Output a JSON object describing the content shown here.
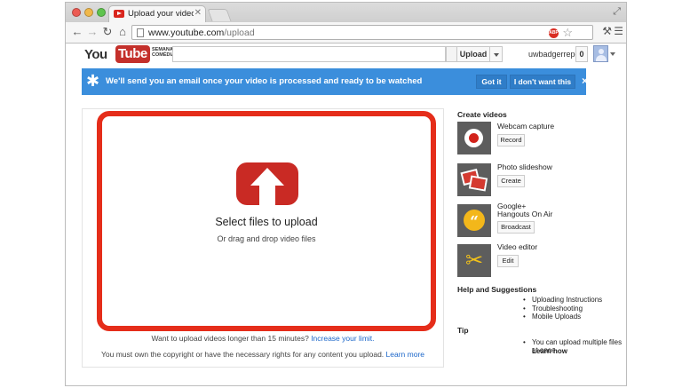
{
  "browser": {
    "tab_title": "Upload your video - YouTube",
    "url_scheme": "www.youtube.com",
    "url_path": "/upload",
    "abp_badge": "ABP"
  },
  "header": {
    "logo_you": "You",
    "logo_tube": "Tube",
    "logo_tagline": "SEMANA DA COMÉDIA",
    "upload_label": "Upload",
    "username": "uwbadgerreport",
    "notification_count": "0"
  },
  "notice": {
    "message": "We'll send you an email once your video is processed and ready to be watched",
    "got_it": "Got it",
    "dont_want": "I don't want this",
    "close": "×"
  },
  "upload": {
    "select_files": "Select files to upload",
    "drag_drop": "Or drag and drop video files",
    "long_prefix": "Want to upload videos longer than 15 minutes?",
    "long_link": "Increase your limit.",
    "copyright_prefix": "You must own the copyright or have the necessary rights for any content you upload.",
    "copyright_link": "Learn more"
  },
  "sidebar": {
    "create_heading": "Create videos",
    "cards": [
      {
        "title": "Webcam capture",
        "button": "Record",
        "icon": "record-icon"
      },
      {
        "title": "Photo slideshow",
        "button": "Create",
        "icon": "photo-slideshow-icon"
      },
      {
        "title": "Google+ Hangouts On Air",
        "button": "Broadcast",
        "icon": "hangouts-icon"
      },
      {
        "title": "Video editor",
        "button": "Edit",
        "icon": "scissors-icon"
      }
    ],
    "help_heading": "Help and Suggestions",
    "help_links": [
      "Uploading Instructions",
      "Troubleshooting",
      "Mobile Uploads"
    ],
    "tip_heading": "Tip",
    "tip_text": "You can upload multiple files at once.",
    "tip_link": "Learn how"
  },
  "colors": {
    "brand_red": "#c92a24",
    "drop_border": "#e52d1a",
    "notice_blue": "#3b8edc",
    "link_blue": "#1b66c9"
  }
}
